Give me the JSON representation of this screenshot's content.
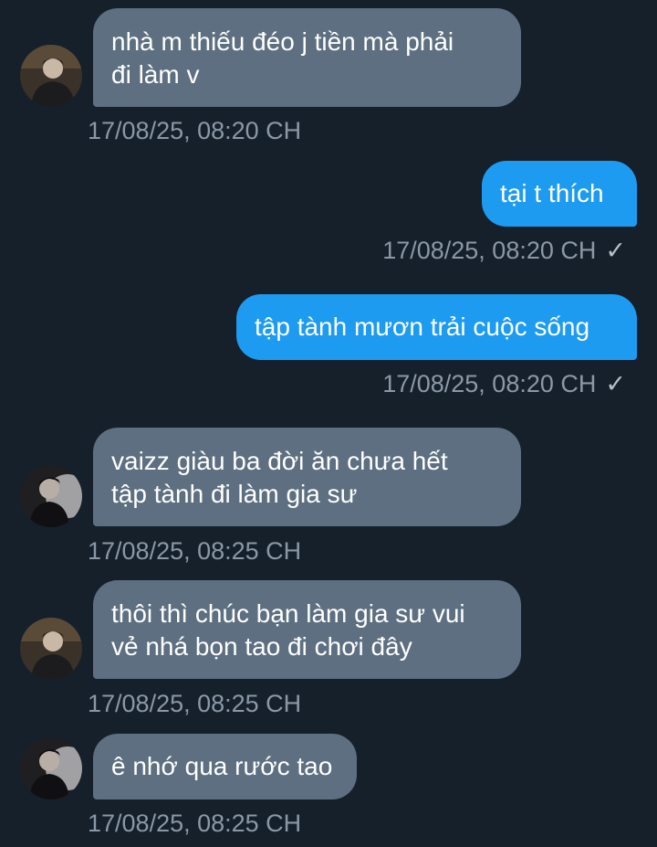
{
  "messages": [
    {
      "direction": "in",
      "lines": [
        "nhà m thiếu đéo j tiền mà phải",
        "đi làm v"
      ],
      "timestamp": "17/08/25, 08:20 CH"
    },
    {
      "direction": "out",
      "lines": [
        "tại t thích"
      ],
      "timestamp": "17/08/25, 08:20 CH",
      "status_icon": "✓"
    },
    {
      "direction": "out",
      "lines": [
        "tập tành mươn trải cuộc sống"
      ],
      "timestamp": "17/08/25, 08:20 CH",
      "status_icon": "✓"
    },
    {
      "direction": "in",
      "lines": [
        "vaizz giàu ba đời ăn chưa hết",
        "tập tành đi làm gia sư"
      ],
      "timestamp": "17/08/25, 08:25 CH"
    },
    {
      "direction": "in",
      "lines": [
        "thôi thì chúc bạn làm gia sư vui",
        "vẻ nhá bọn tao đi chơi đây"
      ],
      "timestamp": "17/08/25, 08:25 CH"
    },
    {
      "direction": "in",
      "lines": [
        "ê nhớ qua rước tao"
      ],
      "timestamp": "17/08/25, 08:25 CH"
    }
  ],
  "colors": {
    "background": "#15202b",
    "incoming_bubble": "#5d6f80",
    "outgoing_bubble": "#1d9bf0",
    "timestamp": "#8b98a5"
  },
  "icons": {
    "avatar": "user-avatar-icon",
    "sent": "checkmark-icon"
  }
}
